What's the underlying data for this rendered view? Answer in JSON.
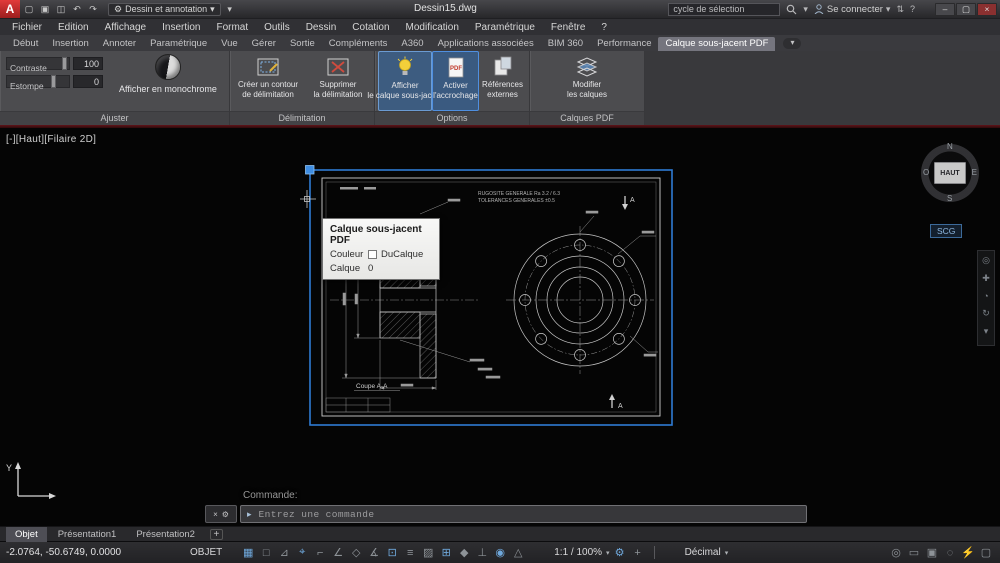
{
  "titlebar": {
    "logo": "A",
    "quick_access": {
      "new": "▢",
      "open": "▣",
      "save": "◫",
      "undo": "↶",
      "redo": "↷",
      "customize": "▾"
    },
    "workspace": {
      "gear": "⚙",
      "label": "Dessin et annotation",
      "caret": "▾"
    },
    "doc_title": "Dessin15.dwg",
    "search": {
      "value": "cycle de sélection",
      "caret": "▾"
    },
    "signin": {
      "label": "Se connecter",
      "caret": "▾"
    },
    "extra": {
      "exchange": "⇅",
      "help": "?"
    },
    "window_controls": {
      "minimize": "–",
      "maximize": "▢",
      "close": "×"
    }
  },
  "menubar": {
    "items": [
      "Fichier",
      "Edition",
      "Affichage",
      "Insertion",
      "Format",
      "Outils",
      "Dessin",
      "Cotation",
      "Modification",
      "Paramétrique",
      "Fenêtre",
      "?"
    ]
  },
  "ribbon_tabs": {
    "items": [
      "Début",
      "Insertion",
      "Annoter",
      "Paramétrique",
      "Vue",
      "Gérer",
      "Sortie",
      "Compléments",
      "A360",
      "Applications associées",
      "BIM 360",
      "Performance"
    ],
    "active": "Calque sous-jacent PDF",
    "collapse": "▾"
  },
  "ribbon": {
    "ajuster": {
      "label": "Ajuster",
      "contraste_label": "Contraste",
      "contraste_value": "100",
      "estompe_label": "Estompe",
      "estompe_value": "0",
      "mono_label": "Afficher en monochrome"
    },
    "delimitation": {
      "label": "Délimitation",
      "create_line1": "Créer un contour",
      "create_line2": "de délimitation",
      "remove_line1": "Supprimer",
      "remove_line2": "la délimitation"
    },
    "options": {
      "label": "Options",
      "show_line1": "Afficher",
      "show_line2": "le calque sous-jacent",
      "snap_line1": "Activer",
      "snap_line2": "l'accrochage",
      "xref_line1": "Références",
      "xref_line2": "externes",
      "pdf_badge": "PDF"
    },
    "calques_pdf": {
      "label": "Calques PDF",
      "edit_line1": "Modifier",
      "edit_line2": "les calques"
    }
  },
  "canvas": {
    "viewport_label": "[-][Haut][Filaire 2D]",
    "compass": {
      "n": "N",
      "o": "O",
      "e": "E",
      "s": "S",
      "center": "HAUT"
    },
    "scg": "SCG",
    "ucs_y": "Y",
    "navbar_icons": {
      "wheel": "◎",
      "pan": "✚",
      "zoom": "◔",
      "orbit": "↻",
      "more": "▾"
    },
    "drawing": {
      "note1": "RUGOSITE GENERALE Ra 3.2 / 6.3",
      "note2": "TOLERANCES GENERALES ±0.5",
      "section_label": "Coupe A-A",
      "marker_a": "A"
    },
    "tooltip": {
      "title": "Calque sous-jacent PDF",
      "row1_label": "Couleur",
      "row1_value": "DuCalque",
      "row2_label": "Calque",
      "row2_value": "0"
    }
  },
  "command": {
    "history": "Commande:",
    "prompt_icon": "▸",
    "placeholder": "Entrez une commande",
    "close": "×",
    "tools": "⚙"
  },
  "layout_tabs": {
    "items": [
      "Objet",
      "Présentation1",
      "Présentation2"
    ],
    "add": "+"
  },
  "statusbar": {
    "coords": "-2.0764, -50.6749, 0.0000",
    "space": "OBJET",
    "icons_left": [
      {
        "name": "grid",
        "glyph": "▦"
      },
      {
        "name": "snap-mode",
        "glyph": "□"
      },
      {
        "name": "infer-constraints",
        "glyph": "⊿"
      },
      {
        "name": "dynamic-input",
        "glyph": "⌖"
      },
      {
        "name": "ortho",
        "glyph": "⌐"
      },
      {
        "name": "polar-tracking",
        "glyph": "∠"
      },
      {
        "name": "isometric-drafting",
        "glyph": "◇"
      },
      {
        "name": "object-snap-tracking",
        "glyph": "∡"
      },
      {
        "name": "object-snap",
        "glyph": "⊡"
      },
      {
        "name": "lineweight",
        "glyph": "≡"
      },
      {
        "name": "transparency",
        "glyph": "▨"
      },
      {
        "name": "selection-cycling",
        "glyph": "⊞"
      },
      {
        "name": "3d-object-snap",
        "glyph": "◆"
      },
      {
        "name": "dynamic-ucs",
        "glyph": "⊥"
      },
      {
        "name": "annotation-visibility",
        "glyph": "◉"
      },
      {
        "name": "autoscale",
        "glyph": "△"
      }
    ],
    "scale": "1:1 / 100%",
    "caret": "▾",
    "icons_mid": [
      {
        "name": "annotation-scale-settings",
        "glyph": "⚙"
      },
      {
        "name": "add-annotation-scales",
        "glyph": "+"
      }
    ],
    "units": "Décimal",
    "icons_right": [
      {
        "name": "annotation-monitor",
        "glyph": "◎"
      },
      {
        "name": "quick-properties",
        "glyph": "▭"
      },
      {
        "name": "lock-ui",
        "glyph": "▣"
      },
      {
        "name": "isolate-objects",
        "glyph": "◌"
      },
      {
        "name": "graphics-performance",
        "glyph": "⚡"
      },
      {
        "name": "clean-screen",
        "glyph": "▢"
      }
    ]
  }
}
